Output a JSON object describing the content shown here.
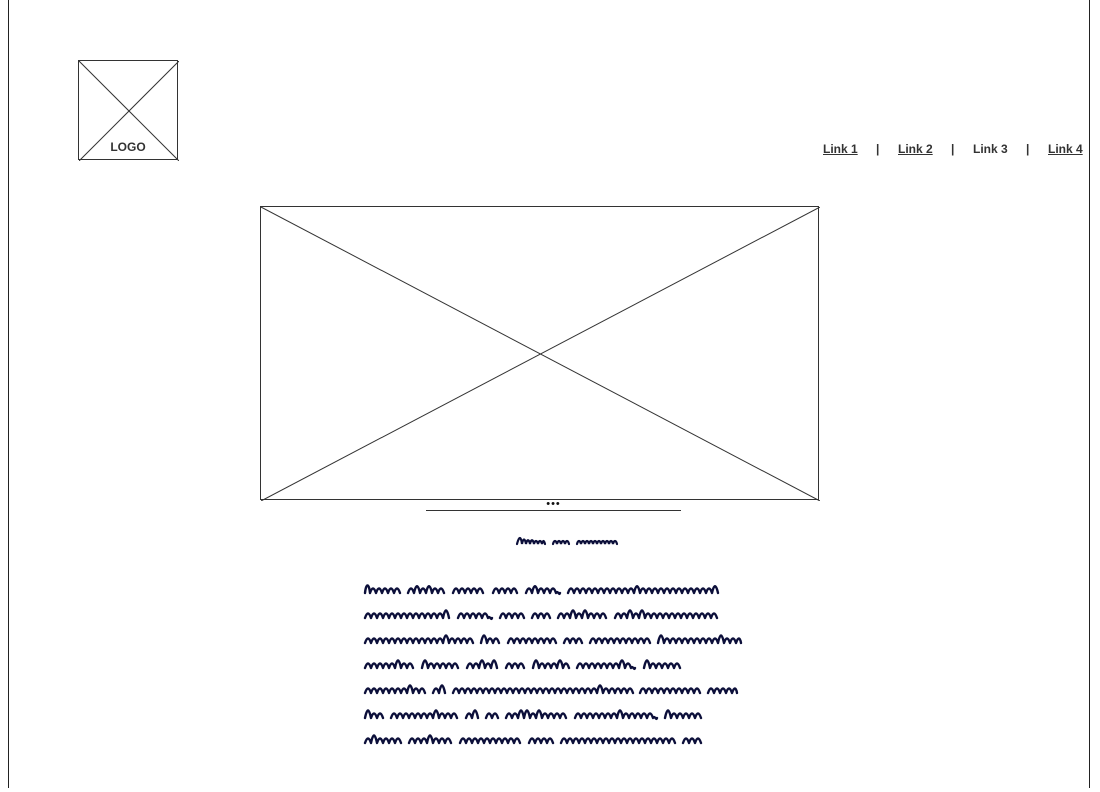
{
  "logo": {
    "label": "LOGO"
  },
  "nav": {
    "links": [
      {
        "label": "Link 1",
        "underlined": true
      },
      {
        "label": "Link 2",
        "underlined": true
      },
      {
        "label": "Link 3",
        "underlined": false
      },
      {
        "label": "Link 4",
        "underlined": true
      }
    ],
    "separator": "|"
  },
  "hero": {
    "kind": "image-placeholder"
  },
  "pager": {
    "dots": "•••"
  },
  "content": {
    "title": {
      "kind": "illegible-scribble",
      "color": "#0c0f3a"
    },
    "paragraph": {
      "kind": "illegible-scribble",
      "lines": 7,
      "color": "#0c0f3a"
    }
  }
}
